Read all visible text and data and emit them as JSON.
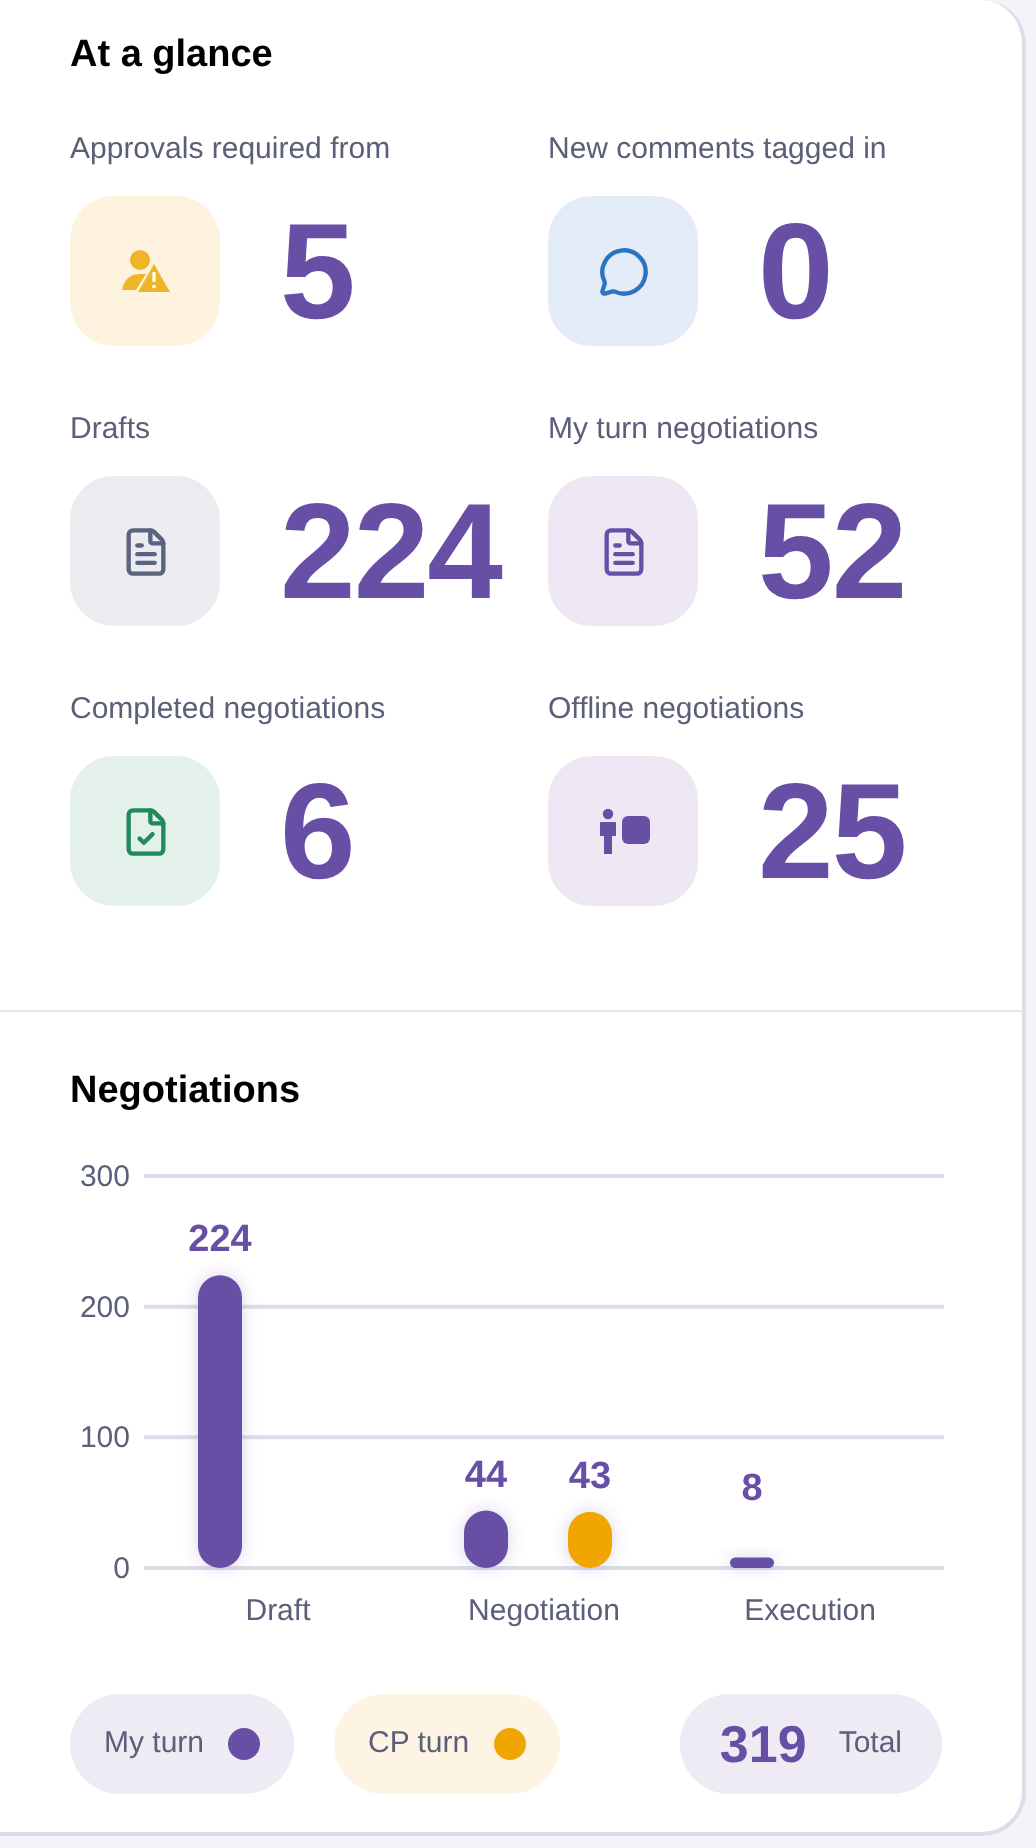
{
  "glance": {
    "title": "At a glance",
    "stats": [
      {
        "kind": "approval",
        "label": "Approvals required from",
        "value": "5"
      },
      {
        "kind": "comment",
        "label": "New comments tagged in",
        "value": "0"
      },
      {
        "kind": "draft",
        "label": "Drafts",
        "value": "224"
      },
      {
        "kind": "myturn",
        "label": "My turn negotiations",
        "value": "52"
      },
      {
        "kind": "completed",
        "label": "Completed negotiations",
        "value": "6"
      },
      {
        "kind": "offline",
        "label": "Offline negotiations",
        "value": "25"
      }
    ]
  },
  "negotiations": {
    "title": "Negotiations",
    "chart_data": {
      "type": "bar",
      "categories": [
        "Draft",
        "Negotiation",
        "Execution"
      ],
      "series": [
        {
          "name": "My turn",
          "color": "#674fa6",
          "values": [
            224,
            44,
            8
          ]
        },
        {
          "name": "CP turn",
          "color": "#f0a500",
          "values": [
            null,
            43,
            null
          ]
        }
      ],
      "ylim": [
        0,
        300
      ],
      "yticks": [
        0,
        100,
        200,
        300
      ],
      "data_labels": true
    },
    "total": {
      "value": "319",
      "label": "Total"
    }
  }
}
